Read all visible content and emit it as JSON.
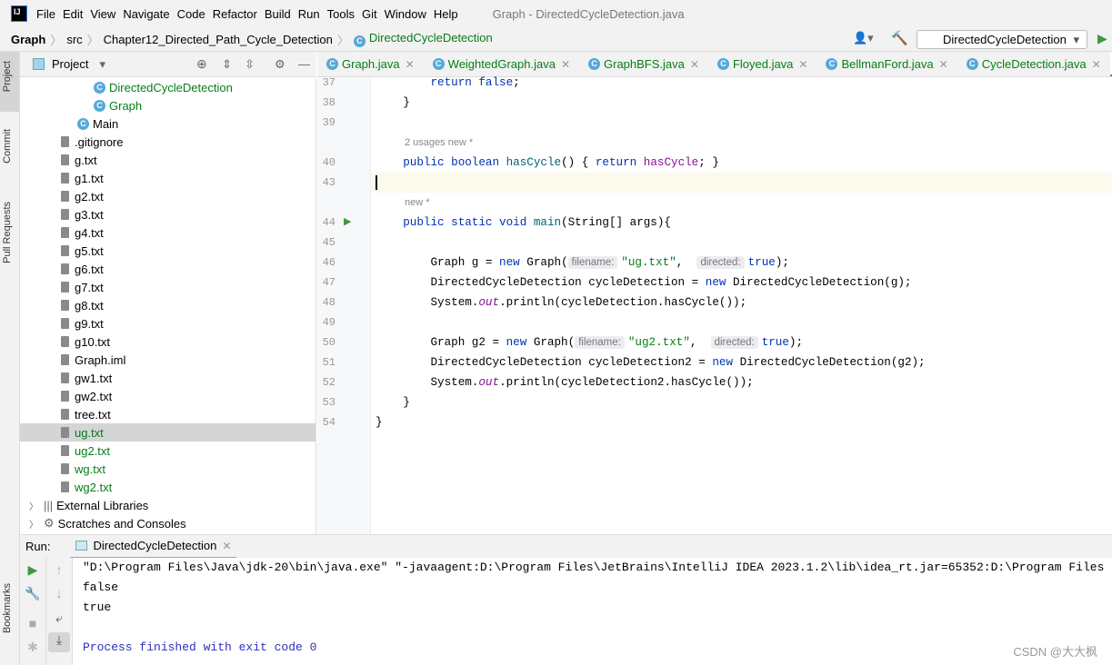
{
  "menubar": {
    "items": [
      "File",
      "Edit",
      "View",
      "Navigate",
      "Code",
      "Refactor",
      "Build",
      "Run",
      "Tools",
      "Git",
      "Window",
      "Help"
    ],
    "window_title": "Graph - DirectedCycleDetection.java",
    "logo": "IJ"
  },
  "breadcrumb": [
    "Graph",
    "src",
    "Chapter12_Directed_Path_Cycle_Detection",
    "DirectedCycleDetection"
  ],
  "run_config": "DirectedCycleDetection",
  "side_tabs": [
    "Project",
    "Commit",
    "Pull Requests",
    "Bookmarks"
  ],
  "project": {
    "title": "Project",
    "tree": [
      {
        "label": "DirectedCycleDetection",
        "type": "class",
        "level": 3,
        "color": "green"
      },
      {
        "label": "Graph",
        "type": "class",
        "level": 3,
        "color": "green"
      },
      {
        "label": "Main",
        "type": "class",
        "level": 2,
        "color": "black"
      },
      {
        "label": ".gitignore",
        "type": "file",
        "level": 1,
        "color": "black"
      },
      {
        "label": "g.txt",
        "type": "file",
        "level": 1,
        "color": "black"
      },
      {
        "label": "g1.txt",
        "type": "file",
        "level": 1,
        "color": "black"
      },
      {
        "label": "g2.txt",
        "type": "file",
        "level": 1,
        "color": "black"
      },
      {
        "label": "g3.txt",
        "type": "file",
        "level": 1,
        "color": "black"
      },
      {
        "label": "g4.txt",
        "type": "file",
        "level": 1,
        "color": "black"
      },
      {
        "label": "g5.txt",
        "type": "file",
        "level": 1,
        "color": "black"
      },
      {
        "label": "g6.txt",
        "type": "file",
        "level": 1,
        "color": "black"
      },
      {
        "label": "g7.txt",
        "type": "file",
        "level": 1,
        "color": "black"
      },
      {
        "label": "g8.txt",
        "type": "file",
        "level": 1,
        "color": "black"
      },
      {
        "label": "g9.txt",
        "type": "file",
        "level": 1,
        "color": "black"
      },
      {
        "label": "g10.txt",
        "type": "file",
        "level": 1,
        "color": "black"
      },
      {
        "label": "Graph.iml",
        "type": "file",
        "level": 1,
        "color": "black"
      },
      {
        "label": "gw1.txt",
        "type": "file",
        "level": 1,
        "color": "black"
      },
      {
        "label": "gw2.txt",
        "type": "file",
        "level": 1,
        "color": "black"
      },
      {
        "label": "tree.txt",
        "type": "file",
        "level": 1,
        "color": "black"
      },
      {
        "label": "ug.txt",
        "type": "file",
        "level": 1,
        "color": "green",
        "selected": true
      },
      {
        "label": "ug2.txt",
        "type": "file",
        "level": 1,
        "color": "green"
      },
      {
        "label": "wg.txt",
        "type": "file",
        "level": 1,
        "color": "green"
      },
      {
        "label": "wg2.txt",
        "type": "file",
        "level": 1,
        "color": "green"
      },
      {
        "label": "External Libraries",
        "type": "lib",
        "level": 0,
        "color": "black"
      },
      {
        "label": "Scratches and Consoles",
        "type": "scratch",
        "level": 0,
        "color": "black"
      }
    ]
  },
  "tabs": [
    {
      "label": "Graph.java"
    },
    {
      "label": "WeightedGraph.java"
    },
    {
      "label": "GraphBFS.java"
    },
    {
      "label": "Floyed.java"
    },
    {
      "label": "BellmanFord.java"
    },
    {
      "label": "CycleDetection.java"
    },
    {
      "label": "DirectedCycleDetection.java",
      "active": true
    }
  ],
  "editor": {
    "lines": [
      {
        "n": "37",
        "tokens": [
          [
            "",
            "        "
          ],
          [
            "kw",
            "return false"
          ],
          [
            "",
            ";"
          ]
        ]
      },
      {
        "n": "38",
        "tokens": [
          [
            "",
            "    }"
          ]
        ]
      },
      {
        "n": "39",
        "tokens": []
      },
      {
        "lens": "2 usages   new *"
      },
      {
        "n": "40",
        "tokens": [
          [
            "",
            "    "
          ],
          [
            "kw",
            "public boolean "
          ],
          [
            "fn",
            "hasCycle"
          ],
          [
            "",
            "() { "
          ],
          [
            "kw",
            "return "
          ],
          [
            "fld",
            "hasCycle"
          ],
          [
            "",
            "; }"
          ]
        ]
      },
      {
        "n": "43",
        "tokens": [],
        "current": true
      },
      {
        "lens": "new *"
      },
      {
        "n": "44",
        "run": true,
        "tokens": [
          [
            "",
            "    "
          ],
          [
            "kw",
            "public static void "
          ],
          [
            "fn",
            "main"
          ],
          [
            "",
            "(String[] args){"
          ]
        ]
      },
      {
        "n": "45",
        "tokens": []
      },
      {
        "n": "46",
        "tokens": [
          [
            "",
            "        Graph g = "
          ],
          [
            "kw",
            "new "
          ],
          [
            "",
            "Graph("
          ],
          [
            "hint",
            "filename:"
          ],
          [
            "str",
            "\"ug.txt\""
          ],
          [
            "",
            ",  "
          ],
          [
            "hint",
            "directed:"
          ],
          [
            "kw",
            "true"
          ],
          [
            "",
            ");"
          ]
        ]
      },
      {
        "n": "47",
        "tokens": [
          [
            "",
            "        DirectedCycleDetection cycleDetection = "
          ],
          [
            "kw",
            "new "
          ],
          [
            "",
            "DirectedCycleDetection(g);"
          ]
        ]
      },
      {
        "n": "48",
        "tokens": [
          [
            "",
            "        System."
          ],
          [
            "it",
            "out"
          ],
          [
            "",
            ".println(cycleDetection.hasCycle());"
          ]
        ]
      },
      {
        "n": "49",
        "tokens": []
      },
      {
        "n": "50",
        "tokens": [
          [
            "",
            "        Graph g2 = "
          ],
          [
            "kw",
            "new "
          ],
          [
            "",
            "Graph("
          ],
          [
            "hint",
            "filename:"
          ],
          [
            "str",
            "\"ug2.txt\""
          ],
          [
            "",
            ",  "
          ],
          [
            "hint",
            "directed:"
          ],
          [
            "kw",
            "true"
          ],
          [
            "",
            ");"
          ]
        ]
      },
      {
        "n": "51",
        "tokens": [
          [
            "",
            "        DirectedCycleDetection cycleDetection2 = "
          ],
          [
            "kw",
            "new "
          ],
          [
            "",
            "DirectedCycleDetection(g2);"
          ]
        ]
      },
      {
        "n": "52",
        "tokens": [
          [
            "",
            "        System."
          ],
          [
            "it",
            "out"
          ],
          [
            "",
            ".println(cycleDetection2.hasCycle());"
          ]
        ]
      },
      {
        "n": "53",
        "tokens": [
          [
            "",
            "    }"
          ]
        ]
      },
      {
        "n": "54",
        "tokens": [
          [
            "",
            "}"
          ]
        ]
      }
    ]
  },
  "run": {
    "label": "Run:",
    "tab": "DirectedCycleDetection",
    "output": [
      "\"D:\\Program Files\\Java\\jdk-20\\bin\\java.exe\" \"-javaagent:D:\\Program Files\\JetBrains\\IntelliJ IDEA 2023.1.2\\lib\\idea_rt.jar=65352:D:\\Program Files",
      "false",
      "true",
      "",
      "Process finished with exit code 0"
    ]
  },
  "watermark": "CSDN @大大枫"
}
